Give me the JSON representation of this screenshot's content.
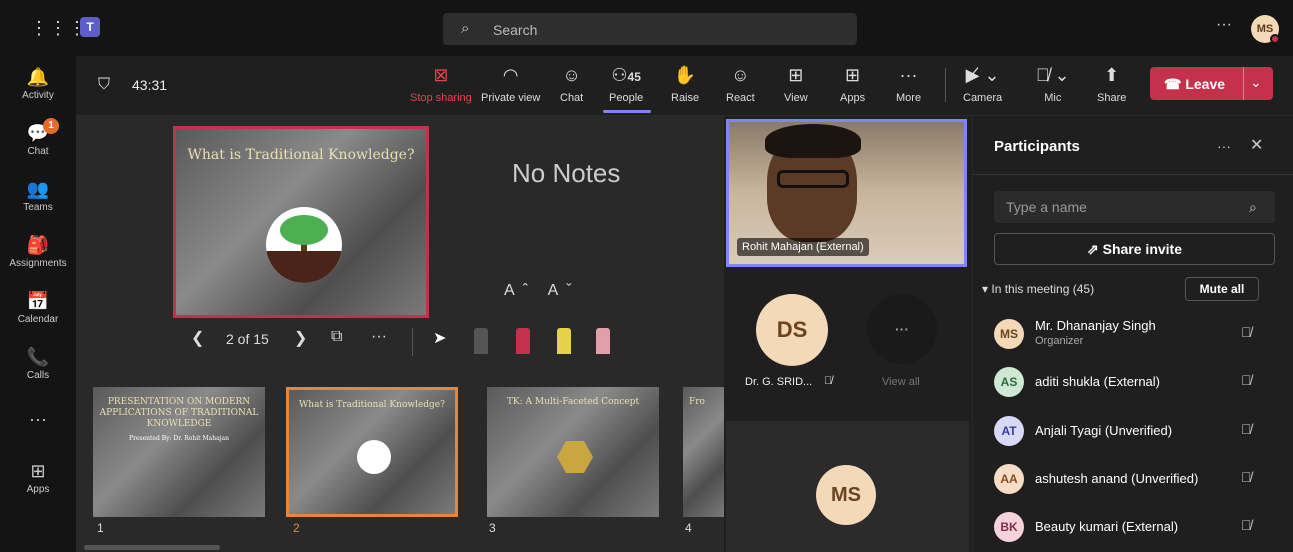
{
  "topbar": {
    "search_placeholder": "Search",
    "waffle_icon": "⋮⋮⋮",
    "app_logo": "T",
    "more": "···",
    "user_initials": "MS"
  },
  "rail": [
    {
      "icon": "🔔",
      "label": "Activity"
    },
    {
      "icon": "💬",
      "label": "Chat",
      "badge": "1"
    },
    {
      "icon": "👥",
      "label": "Teams"
    },
    {
      "icon": "🎒",
      "label": "Assignments"
    },
    {
      "icon": "📅",
      "label": "Calendar"
    },
    {
      "icon": "📞",
      "label": "Calls"
    },
    {
      "icon": "···",
      "label": ""
    },
    {
      "icon": "⊞",
      "label": "Apps"
    }
  ],
  "meeting": {
    "timer": "43:31",
    "controls": {
      "stop_sharing": "Stop sharing",
      "private_view": "Private view",
      "chat": "Chat",
      "people": "People",
      "people_count": "45",
      "raise": "Raise",
      "react": "React",
      "view": "View",
      "apps": "Apps",
      "more": "More",
      "camera": "Camera",
      "mic": "Mic",
      "share": "Share",
      "leave": "Leave"
    }
  },
  "presenter": {
    "current_slide_title": "What is Traditional Knowledge?",
    "notes": "No Notes",
    "font_controls": "Aˆ Aˇ",
    "slide_position": "2 of 15",
    "thumbnails": [
      {
        "number": "1",
        "title": "PRESENTATION ON MODERN APPLICATIONS OF TRADITIONAL KNOWLEDGE",
        "sub": "Presented By: Dr. Rohit Mahajan"
      },
      {
        "number": "2",
        "title": "What is Traditional Knowledge?",
        "sub": "",
        "selected": true
      },
      {
        "number": "3",
        "title": "TK: A Multi-Faceted Concept",
        "sub": ""
      },
      {
        "number": "4",
        "title": "Fro",
        "sub": ""
      }
    ]
  },
  "videos": {
    "main_caption": "Rohit Mahajan (External)",
    "tile1_initials": "DS",
    "tile1_name": "Dr. G. SRID...",
    "view_all": "View all",
    "view_all_icon": "···",
    "tile2_initials": "MS"
  },
  "participants": {
    "title": "Participants",
    "search_placeholder": "Type a name",
    "share_invite": "Share invite",
    "section": "In this meeting (45)",
    "mute_all": "Mute all",
    "people": [
      {
        "initials": "MS",
        "name": "Mr. Dhananjay Singh",
        "role": "Organizer",
        "color": "#f3d9b8",
        "text": "#6b4320"
      },
      {
        "initials": "AS",
        "name": "aditi shukla (External)",
        "role": "",
        "color": "#cfe8d4",
        "text": "#2e6b3b"
      },
      {
        "initials": "AT",
        "name": "Anjali Tyagi (Unverified)",
        "role": "",
        "color": "#d7d9f7",
        "text": "#3b3f9a"
      },
      {
        "initials": "AA",
        "name": "ashutesh anand (Unverified)",
        "role": "",
        "color": "#f7dcc6",
        "text": "#8a4a1c"
      },
      {
        "initials": "BK",
        "name": "Beauty kumari (External)",
        "role": "",
        "color": "#f5d2dc",
        "text": "#8a2a4a"
      }
    ]
  }
}
